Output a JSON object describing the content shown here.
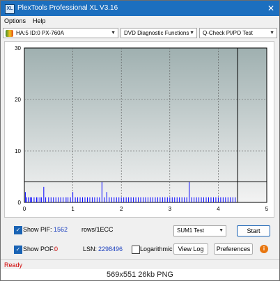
{
  "window": {
    "title": "PlexTools Professional XL V3.16",
    "app_icon_text": "XL"
  },
  "menu": {
    "items": [
      "Options",
      "Help"
    ]
  },
  "toolbar": {
    "drive": "HA:5 ID:0  PX-760A",
    "function": "DVD Diagnostic Functions",
    "test": "Q-Check PI/PO Test"
  },
  "chart_data": {
    "type": "bar",
    "title": "",
    "xlabel": "",
    "ylabel": "",
    "xlim": [
      0,
      5
    ],
    "ylim": [
      0,
      30
    ],
    "xticks": [
      0,
      1,
      2,
      3,
      4,
      5
    ],
    "yticks": [
      0,
      10,
      20,
      30
    ],
    "grid": true,
    "threshold_line": 4,
    "end_marker_x": 4.4,
    "series": [
      {
        "type": "bar",
        "color": "#0000ff",
        "x": [
          0.02,
          0.05,
          0.08,
          0.12,
          0.15,
          0.2,
          0.25,
          0.28,
          0.32,
          0.35,
          0.4,
          0.44,
          0.5,
          0.55,
          0.6,
          0.65,
          0.7,
          0.75,
          0.8,
          0.86,
          0.9,
          0.95,
          1.0,
          1.05,
          1.1,
          1.15,
          1.2,
          1.25,
          1.3,
          1.35,
          1.4,
          1.45,
          1.5,
          1.55,
          1.6,
          1.65,
          1.7,
          1.75,
          1.8,
          1.85,
          1.9,
          1.95,
          2.0,
          2.05,
          2.1,
          2.15,
          2.2,
          2.25,
          2.3,
          2.35,
          2.4,
          2.45,
          2.5,
          2.55,
          2.6,
          2.65,
          2.7,
          2.75,
          2.8,
          2.85,
          2.9,
          2.95,
          3.0,
          3.05,
          3.1,
          3.15,
          3.2,
          3.25,
          3.3,
          3.35,
          3.4,
          3.45,
          3.5,
          3.55,
          3.6,
          3.65,
          3.7,
          3.75,
          3.8,
          3.85,
          3.9,
          3.95,
          4.0,
          4.05,
          4.1,
          4.15,
          4.2,
          4.25,
          4.3,
          4.35
        ],
        "values": [
          2,
          1,
          1,
          1,
          1,
          1,
          1,
          1,
          1,
          1,
          3,
          1,
          1,
          1,
          1,
          1,
          1,
          1,
          1,
          1,
          1,
          1,
          2,
          1,
          1,
          1,
          1,
          1,
          1,
          1,
          1,
          1,
          1,
          1,
          4,
          1,
          2,
          1,
          1,
          1,
          1,
          1,
          1,
          1,
          1,
          1,
          1,
          1,
          1,
          1,
          1,
          1,
          1,
          1,
          1,
          1,
          1,
          1,
          1,
          1,
          1,
          1,
          1,
          1,
          1,
          1,
          1,
          1,
          1,
          1,
          4,
          1,
          1,
          1,
          1,
          1,
          1,
          1,
          1,
          1,
          1,
          1,
          1,
          1,
          1,
          1,
          1,
          1,
          1,
          1
        ]
      }
    ]
  },
  "controls": {
    "show_pif_label": "Show PIF:",
    "pif_value": "1562",
    "rows_label": "rows/1ECC",
    "show_pof_label": "Show POF:",
    "pof_value": "0",
    "lsn_label": "LSN:",
    "lsn_value": "2298496",
    "logarithmic_label": "Logarithmic",
    "sum_select": "SUM1 Test",
    "start_label": "Start",
    "view_log_label": "View Log",
    "preferences_label": "Preferences",
    "check_glyph": "✓",
    "info_glyph": "i"
  },
  "status": {
    "text": "Ready"
  },
  "caption": {
    "text": "569x551  26kb  PNG"
  },
  "colors": {
    "titlebar": "#1c6fbf",
    "plot_bg_top": "#9fb0b0",
    "plot_bg_bottom": "#f3f3f3",
    "bar": "#0000ff",
    "status": "#d00000"
  }
}
